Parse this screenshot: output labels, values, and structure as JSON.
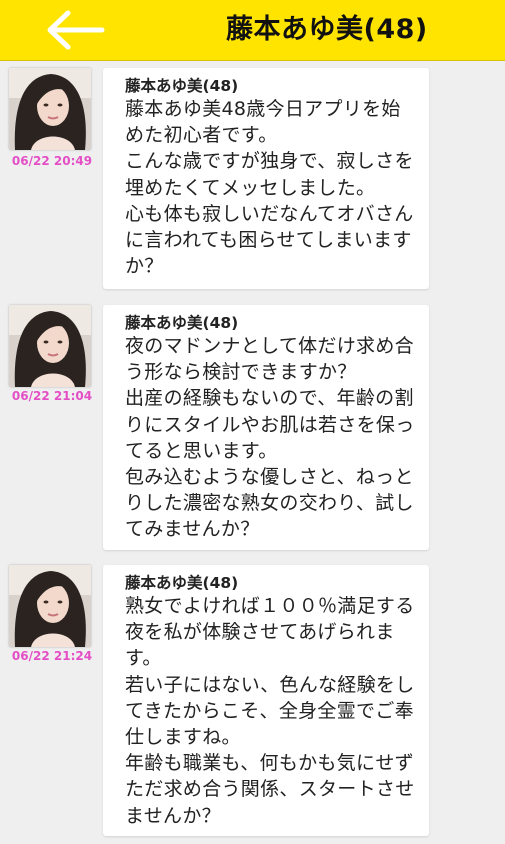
{
  "header": {
    "title": "藤本あゆ美(48)",
    "back_icon": "arrow-left-icon",
    "background": "#ffe400"
  },
  "messages": [
    {
      "time": "06/22 20:49",
      "sender": "藤本あゆ美(48)",
      "text": "藤本あゆ美48歳今日アプリを始めた初心者です。\nこんな歳ですが独身で、寂しさを埋めたくてメッセしました。\n心も体も寂しいだなんてオバさんに言われても困らせてしまいますか？"
    },
    {
      "time": "06/22 21:04",
      "sender": "藤本あゆ美(48)",
      "text": "夜のマドンナとして体だけ求め合う形なら検討できますか？\n出産の経験もないので、年齢の割りにスタイルやお肌は若さを保ってると思います。\n包み込むような優しさと、ねっとりした濃密な熟女の交わり、試してみませんか？"
    },
    {
      "time": "06/22 21:24",
      "sender": "藤本あゆ美(48)",
      "text": "熟女でよければ１００％満足する夜を私が体験させてあげられます。\n若い子にはない、色んな経験をしてきたからこそ、全身全霊でご奉仕しますね。\n年齢も職業も、何もかも気にせずただ求め合う関係、スタートさせませんか？"
    }
  ],
  "colors": {
    "accent": "#ffe400",
    "timestamp": "#e44fc6",
    "page_bg": "#efefef"
  }
}
